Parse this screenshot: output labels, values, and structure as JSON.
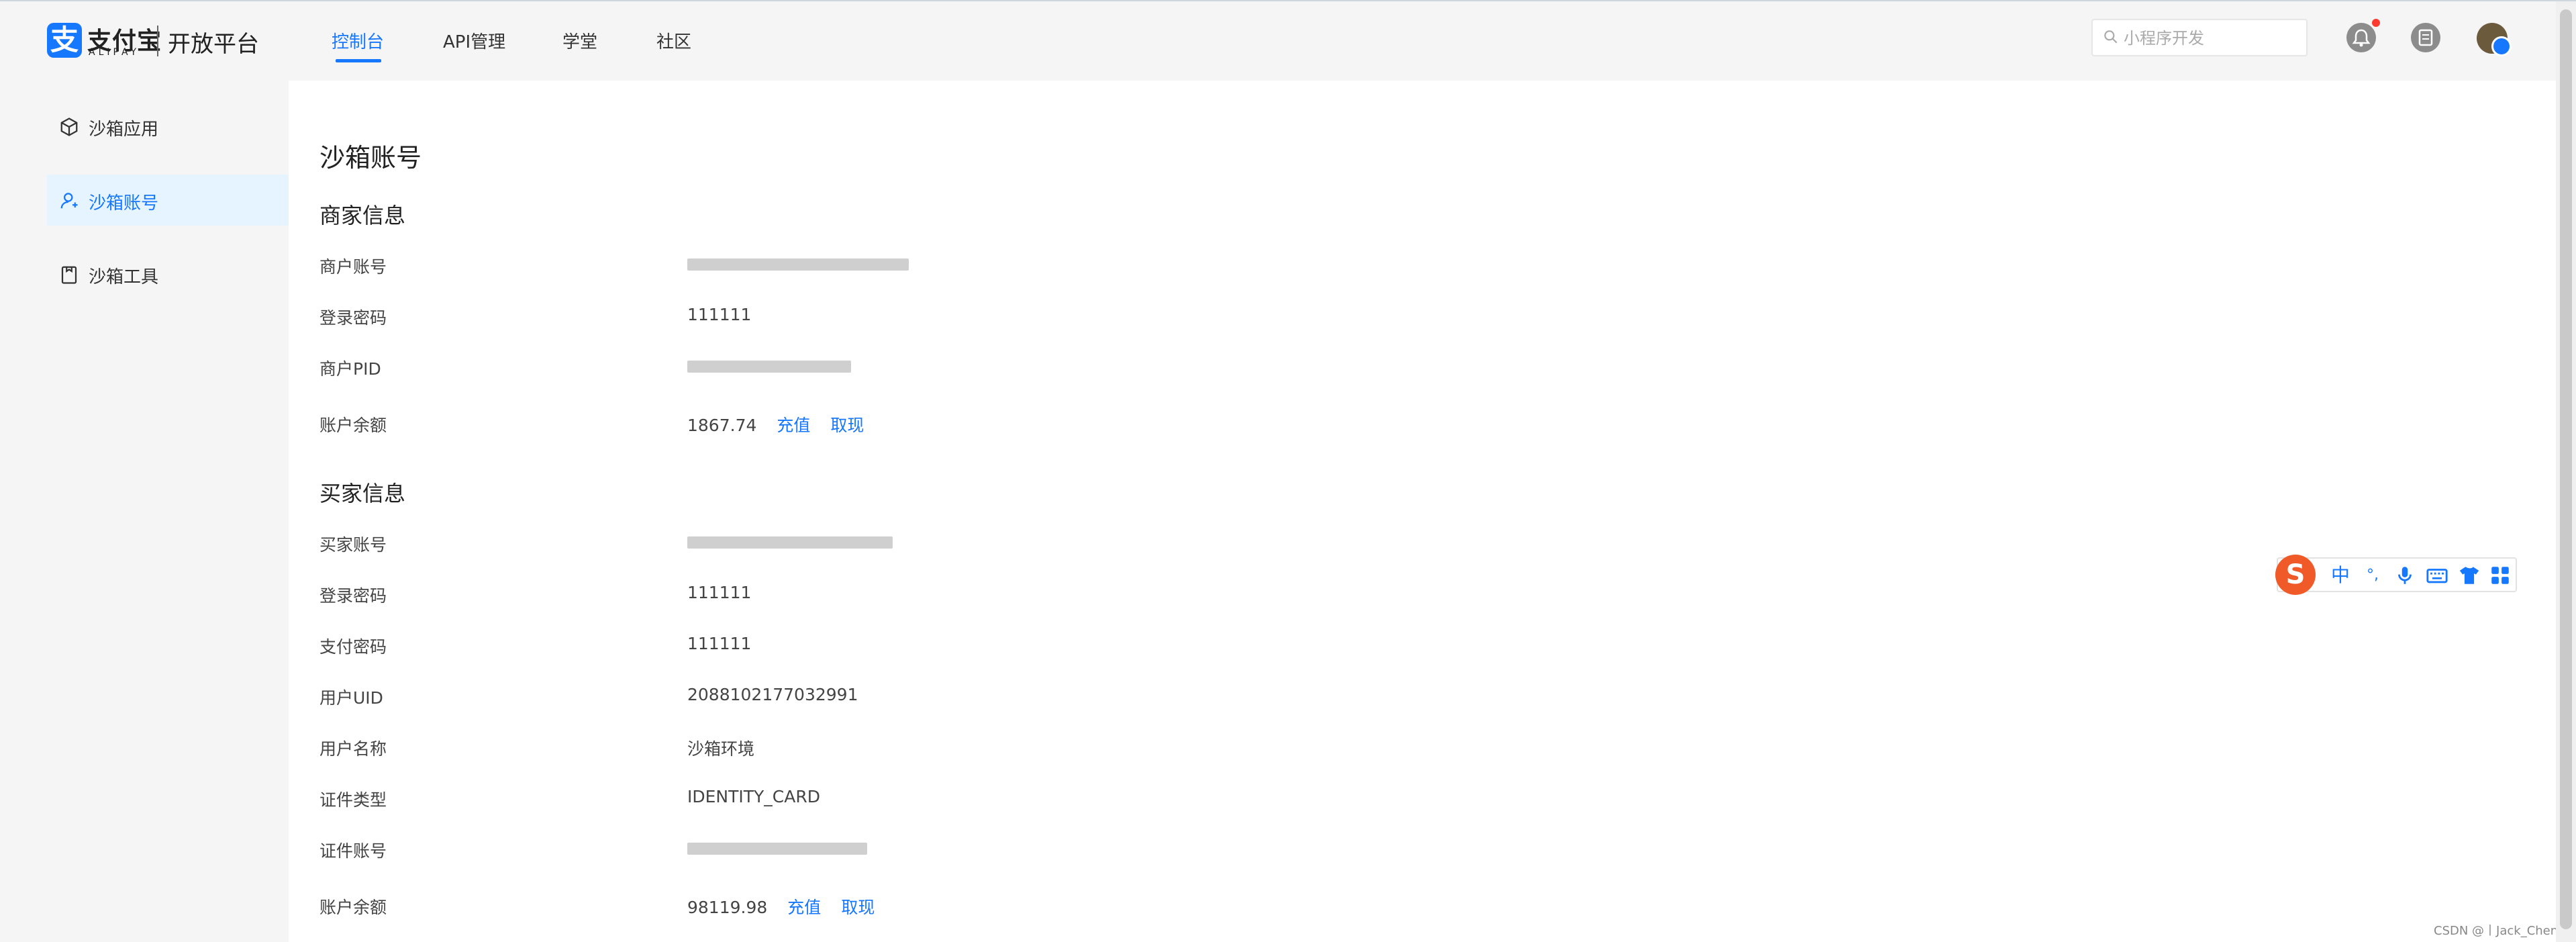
{
  "header": {
    "logo_text": "支付宝",
    "logo_subtext": "ALIPAY",
    "platform": "开放平台",
    "nav": [
      "控制台",
      "API管理",
      "学堂",
      "社区"
    ],
    "search_placeholder": "小程序开发",
    "accent_color": "#1677ff"
  },
  "sidebar": {
    "items": [
      {
        "label": "沙箱应用",
        "icon": "cube-icon"
      },
      {
        "label": "沙箱账号",
        "icon": "user-icon",
        "active": true
      },
      {
        "label": "沙箱工具",
        "icon": "clipboard-icon"
      }
    ]
  },
  "main": {
    "title": "沙箱账号",
    "merchant": {
      "title": "商家信息",
      "rows": [
        {
          "label": "商户账号",
          "value": ""
        },
        {
          "label": "登录密码",
          "value": "111111"
        },
        {
          "label": "商户PID",
          "value": ""
        },
        {
          "label": "账户余额",
          "value": "1867.74",
          "actions": [
            "充值",
            "取现"
          ]
        }
      ]
    },
    "buyer": {
      "title": "买家信息",
      "rows": [
        {
          "label": "买家账号",
          "value": ""
        },
        {
          "label": "登录密码",
          "value": "111111"
        },
        {
          "label": "支付密码",
          "value": "111111"
        },
        {
          "label": "用户UID",
          "value": "2088102177032991"
        },
        {
          "label": "用户名称",
          "value": "沙箱环境"
        },
        {
          "label": "证件类型",
          "value": "IDENTITY_CARD"
        },
        {
          "label": "证件账号",
          "value": ""
        },
        {
          "label": "账户余额",
          "value": "98119.98",
          "actions": [
            "充值",
            "取现"
          ]
        }
      ]
    }
  },
  "ime_toolbar": {
    "logo": "S",
    "items": [
      "中",
      "°,",
      "microphone-icon",
      "keyboard-icon",
      "shirt-icon",
      "grid-icon"
    ]
  },
  "watermark": "CSDN @丨Jack_Chen丨"
}
